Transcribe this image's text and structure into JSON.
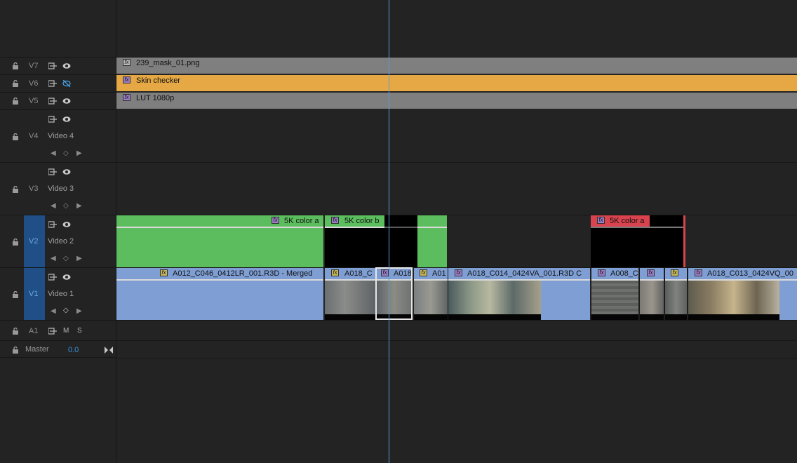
{
  "tracks": [
    {
      "id": "V7",
      "label": ""
    },
    {
      "id": "V6",
      "label": ""
    },
    {
      "id": "V5",
      "label": ""
    },
    {
      "id": "V4",
      "label": "Video 4"
    },
    {
      "id": "V3",
      "label": "Video 3"
    },
    {
      "id": "V2",
      "label": "Video 2"
    },
    {
      "id": "V1",
      "label": "Video 1"
    },
    {
      "id": "A1",
      "label": "",
      "mute": "M",
      "solo": "S"
    }
  ],
  "master": {
    "label": "Master",
    "value": "0.0"
  },
  "clips": {
    "v7": "239_mask_01.png",
    "v6": "Skin checker",
    "v5": "LUT 1080p",
    "v2_a": "5K color a",
    "v2_b": "5K color b",
    "v2_c": "5K color a",
    "v1_a": "A012_C046_0412LR_001.R3D - Merged",
    "v1_b": "A018_C",
    "v1_c": "A018",
    "v1_d": "A01",
    "v1_e": "A018_C014_0424VA_001.R3D C",
    "v1_f": "A008_C",
    "v1_g": "A018_C013_0424VQ_00"
  },
  "colors": {
    "v6_clip": "#e5a845",
    "adjust_clip": "#7f7f7f",
    "v2_clip": "#5bbd5d",
    "v2_red": "#d8434d",
    "v1_clip": "#7f9fd4",
    "playhead": "#5b9ad6",
    "selected_track": "#1f4f86"
  }
}
